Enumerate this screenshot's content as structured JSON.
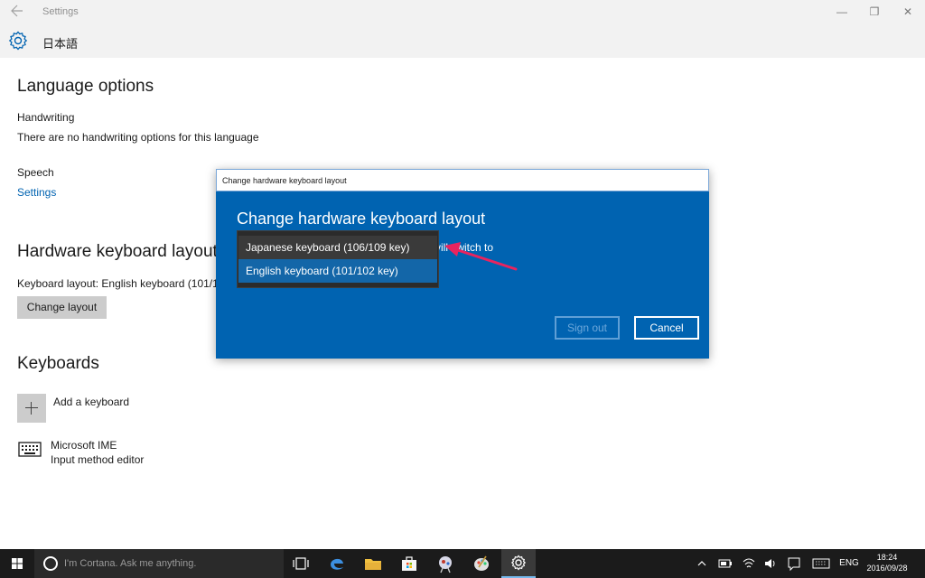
{
  "window": {
    "title": "Settings",
    "controls": {
      "minimize": "—",
      "maximize": "❐",
      "close": "✕"
    }
  },
  "header": {
    "title": "日本語",
    "icon": "gear-icon"
  },
  "language_options": {
    "heading": "Language options",
    "handwriting_label": "Handwriting",
    "handwriting_text": "There are no handwriting options for this language",
    "speech_label": "Speech",
    "speech_link": "Settings"
  },
  "hardware_keyboard": {
    "heading": "Hardware keyboard layout",
    "layout_text": "Keyboard layout:  English keyboard (101/1",
    "change_button": "Change layout"
  },
  "keyboards": {
    "heading": "Keyboards",
    "add_label": "Add a keyboard",
    "items": [
      {
        "name": "Microsoft IME",
        "desc": "Input method editor",
        "icon": "keyboard-icon"
      }
    ]
  },
  "dialog": {
    "window_title": "Change hardware keyboard layout",
    "heading": "Change hardware keyboard layout",
    "body_text": "vill switch to",
    "signout_button": "Sign out",
    "cancel_button": "Cancel",
    "dropdown_options": [
      "Japanese keyboard (106/109 key)",
      "English keyboard (101/102 key)"
    ],
    "highlighted_option": "English keyboard (101/102 key)",
    "annotation_color": "#e8245f"
  },
  "taskbar": {
    "search_placeholder": "I'm Cortana. Ask me anything.",
    "language": "ENG",
    "time": "18:24",
    "date": "2016/09/28",
    "accent": "#76b9ed"
  },
  "colors": {
    "dialog_blue": "#0063b1",
    "link_blue": "#0063b1",
    "taskbar": "#1b1b1b"
  }
}
